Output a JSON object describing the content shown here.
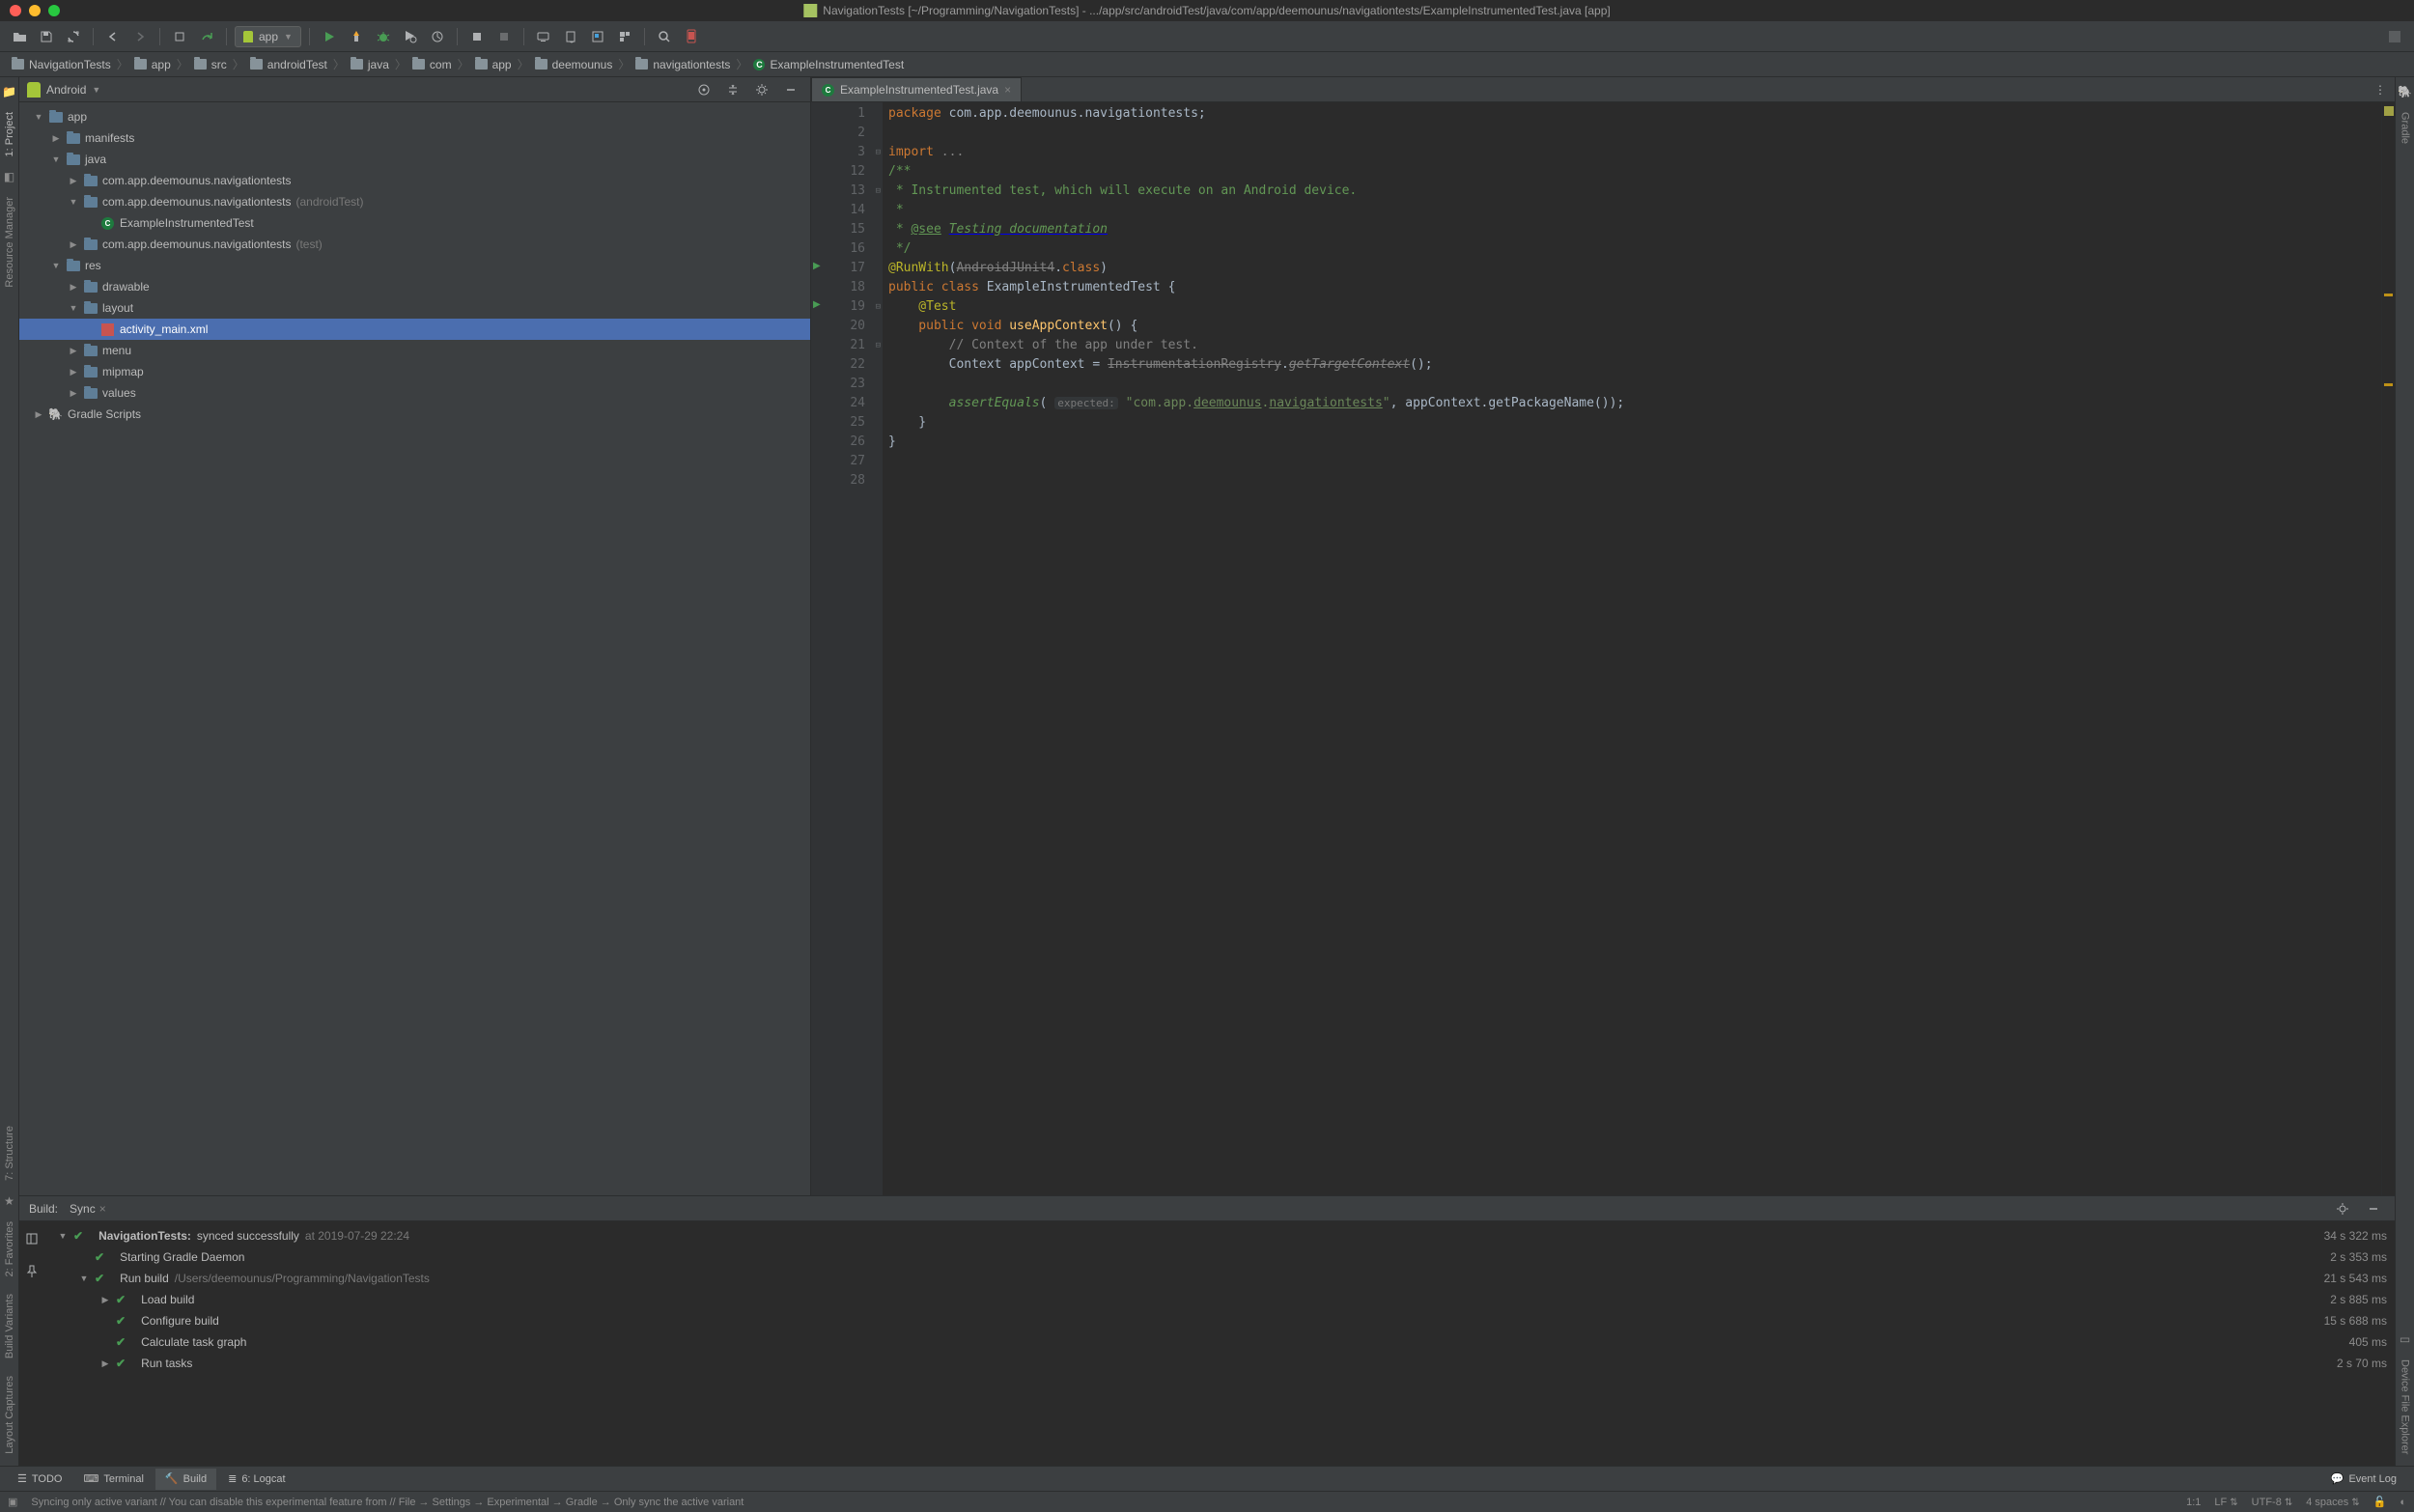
{
  "window": {
    "title": "NavigationTests [~/Programming/NavigationTests] - .../app/src/androidTest/java/com/app/deemounus/navigationtests/ExampleInstrumentedTest.java [app]"
  },
  "toolbar": {
    "run_config": "app"
  },
  "breadcrumbs": [
    {
      "label": "NavigationTests",
      "icon": "folder"
    },
    {
      "label": "app",
      "icon": "folder"
    },
    {
      "label": "src",
      "icon": "folder"
    },
    {
      "label": "androidTest",
      "icon": "folder"
    },
    {
      "label": "java",
      "icon": "folder"
    },
    {
      "label": "com",
      "icon": "folder"
    },
    {
      "label": "app",
      "icon": "folder"
    },
    {
      "label": "deemounus",
      "icon": "folder"
    },
    {
      "label": "navigationtests",
      "icon": "folder"
    },
    {
      "label": "ExampleInstrumentedTest",
      "icon": "class"
    }
  ],
  "left_tool_windows": [
    {
      "label": "1: Project",
      "selected": true
    },
    {
      "label": "Resource Manager"
    },
    {
      "label": "7: Structure"
    },
    {
      "label": "2: Favorites"
    },
    {
      "label": "Build Variants"
    },
    {
      "label": "Layout Captures"
    }
  ],
  "right_tool_windows": [
    {
      "label": "Gradle"
    },
    {
      "label": "Device File Explorer"
    }
  ],
  "project_panel": {
    "title": "Android",
    "tree": [
      {
        "depth": 0,
        "exp": "▼",
        "icon": "module",
        "label": "app"
      },
      {
        "depth": 1,
        "exp": "▶",
        "icon": "folder",
        "label": "manifests"
      },
      {
        "depth": 1,
        "exp": "▼",
        "icon": "folder",
        "label": "java"
      },
      {
        "depth": 2,
        "exp": "▶",
        "icon": "pkg",
        "label": "com.app.deemounus.navigationtests"
      },
      {
        "depth": 2,
        "exp": "▼",
        "icon": "pkg",
        "label": "com.app.deemounus.navigationtests",
        "suffix": "(androidTest)"
      },
      {
        "depth": 3,
        "exp": "",
        "icon": "test",
        "label": "ExampleInstrumentedTest"
      },
      {
        "depth": 2,
        "exp": "▶",
        "icon": "pkg",
        "label": "com.app.deemounus.navigationtests",
        "suffix": "(test)"
      },
      {
        "depth": 1,
        "exp": "▼",
        "icon": "folder",
        "label": "res"
      },
      {
        "depth": 2,
        "exp": "▶",
        "icon": "folder",
        "label": "drawable"
      },
      {
        "depth": 2,
        "exp": "▼",
        "icon": "folder",
        "label": "layout"
      },
      {
        "depth": 3,
        "exp": "",
        "icon": "xml",
        "label": "activity_main.xml",
        "selected": true
      },
      {
        "depth": 2,
        "exp": "▶",
        "icon": "folder",
        "label": "menu"
      },
      {
        "depth": 2,
        "exp": "▶",
        "icon": "folder",
        "label": "mipmap"
      },
      {
        "depth": 2,
        "exp": "▶",
        "icon": "folder",
        "label": "values"
      },
      {
        "depth": 0,
        "exp": "▶",
        "icon": "gradle",
        "label": "Gradle Scripts"
      }
    ]
  },
  "editor": {
    "tab_name": "ExampleInstrumentedTest.java",
    "lines": [
      1,
      2,
      3,
      12,
      13,
      14,
      15,
      16,
      17,
      18,
      19,
      20,
      21,
      22,
      23,
      24,
      25,
      26,
      27,
      28
    ],
    "code": {
      "l1": {
        "pkg": "package",
        "path": " com.app.deemounus.navigationtests;"
      },
      "l3": {
        "imp": "import ",
        "dots": "..."
      },
      "l13": "/**",
      "l14": " * Instrumented test, which will execute on an Android device.",
      "l15": " *",
      "l16a": " * ",
      "l16see": "@see",
      "l16b": " <a href=\"http://d.android.com/tools/testing\">",
      "l16ital": "Testing documentation",
      "l16c": "</a>",
      "l17": " */",
      "l18ann": "@RunWith",
      "l18p1": "(",
      "l18cls": "AndroidJUnit4",
      "l18p2": ".",
      "l18kw": "class",
      "l18p3": ")",
      "l19a": "public class ",
      "l19b": "ExampleInstrumentedTest {",
      "l20": "    @Test",
      "l21a": "    public void ",
      "l21fn": "useAppContext",
      "l21b": "() {",
      "l22": "        // Context of the app under test.",
      "l23a": "        Context appContext = ",
      "l23strike": "InstrumentationRegistry",
      "l23b": ".",
      "l23strike2": "getTargetContext",
      "l23c": "();",
      "l25a": "        ",
      "l25fn": "assertEquals",
      "l25b": "( ",
      "l25hint": "expected:",
      "l25c": " ",
      "l25s1": "\"com.app.",
      "l25s2": "deemounus",
      "l25s3": ".",
      "l25s4": "navigationtests",
      "l25s5": "\"",
      "l25d": ", appContext.getPackageName());",
      "l26": "    }",
      "l27": "}"
    }
  },
  "build": {
    "tab_build": "Build:",
    "tab_sync": "Sync",
    "rows": [
      {
        "depth": 0,
        "exp": "▼",
        "check": true,
        "bold": "NavigationTests:",
        "rest": " synced successfully",
        "muted": " at 2019-07-29 22:24",
        "time": "34 s 322 ms"
      },
      {
        "depth": 1,
        "exp": "",
        "check": true,
        "label": "Starting Gradle Daemon",
        "time": "2 s 353 ms"
      },
      {
        "depth": 1,
        "exp": "▼",
        "check": true,
        "label": "Run build ",
        "muted": "/Users/deemounus/Programming/NavigationTests",
        "time": "21 s 543 ms"
      },
      {
        "depth": 2,
        "exp": "▶",
        "check": true,
        "label": "Load build",
        "time": "2 s 885 ms"
      },
      {
        "depth": 2,
        "exp": "",
        "check": true,
        "label": "Configure build",
        "time": "15 s 688 ms"
      },
      {
        "depth": 2,
        "exp": "",
        "check": true,
        "label": "Calculate task graph",
        "time": "405 ms"
      },
      {
        "depth": 2,
        "exp": "▶",
        "check": true,
        "label": "Run tasks",
        "time": "2 s 70 ms"
      }
    ]
  },
  "bottom_tabs": [
    {
      "label": "TODO",
      "icon": "☰"
    },
    {
      "label": "Terminal",
      "icon": "⌨"
    },
    {
      "label": "Build",
      "icon": "🔨",
      "selected": true
    },
    {
      "label": "6: Logcat",
      "icon": "≣"
    }
  ],
  "bottom_right": {
    "event_log": "Event Log"
  },
  "status": {
    "msg": "Syncing only active variant // You can disable this experimental feature from // File → Settings → Experimental → Gradle → Only sync the active variant",
    "pos": "1:1",
    "le": "LF",
    "le_arrow": "⇅",
    "enc": "UTF-8",
    "enc_arrow": "⇅",
    "indent": "4 spaces",
    "indent_arrow": "⇅"
  }
}
